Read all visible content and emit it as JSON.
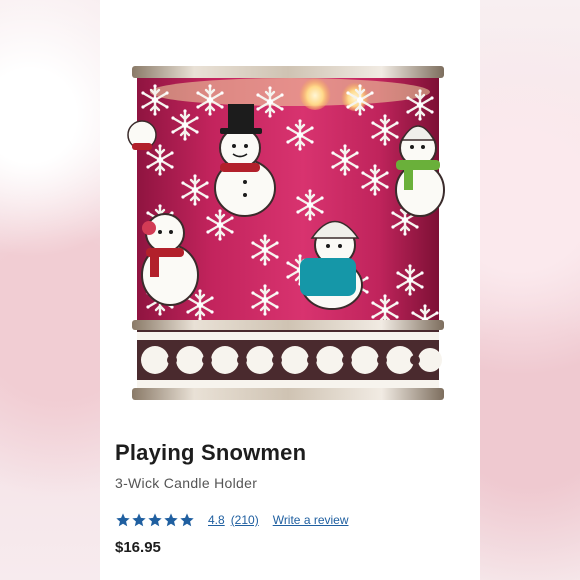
{
  "product": {
    "title": "Playing Snowmen",
    "subtitle": "3-Wick Candle Holder",
    "rating": "4.8",
    "review_count": "(210)",
    "write_review": "Write a review",
    "price": "$16.95",
    "stars": 5
  },
  "colors": {
    "star": "#1f5fa0",
    "link": "#1f5fa0",
    "candle": "#c2185b"
  }
}
